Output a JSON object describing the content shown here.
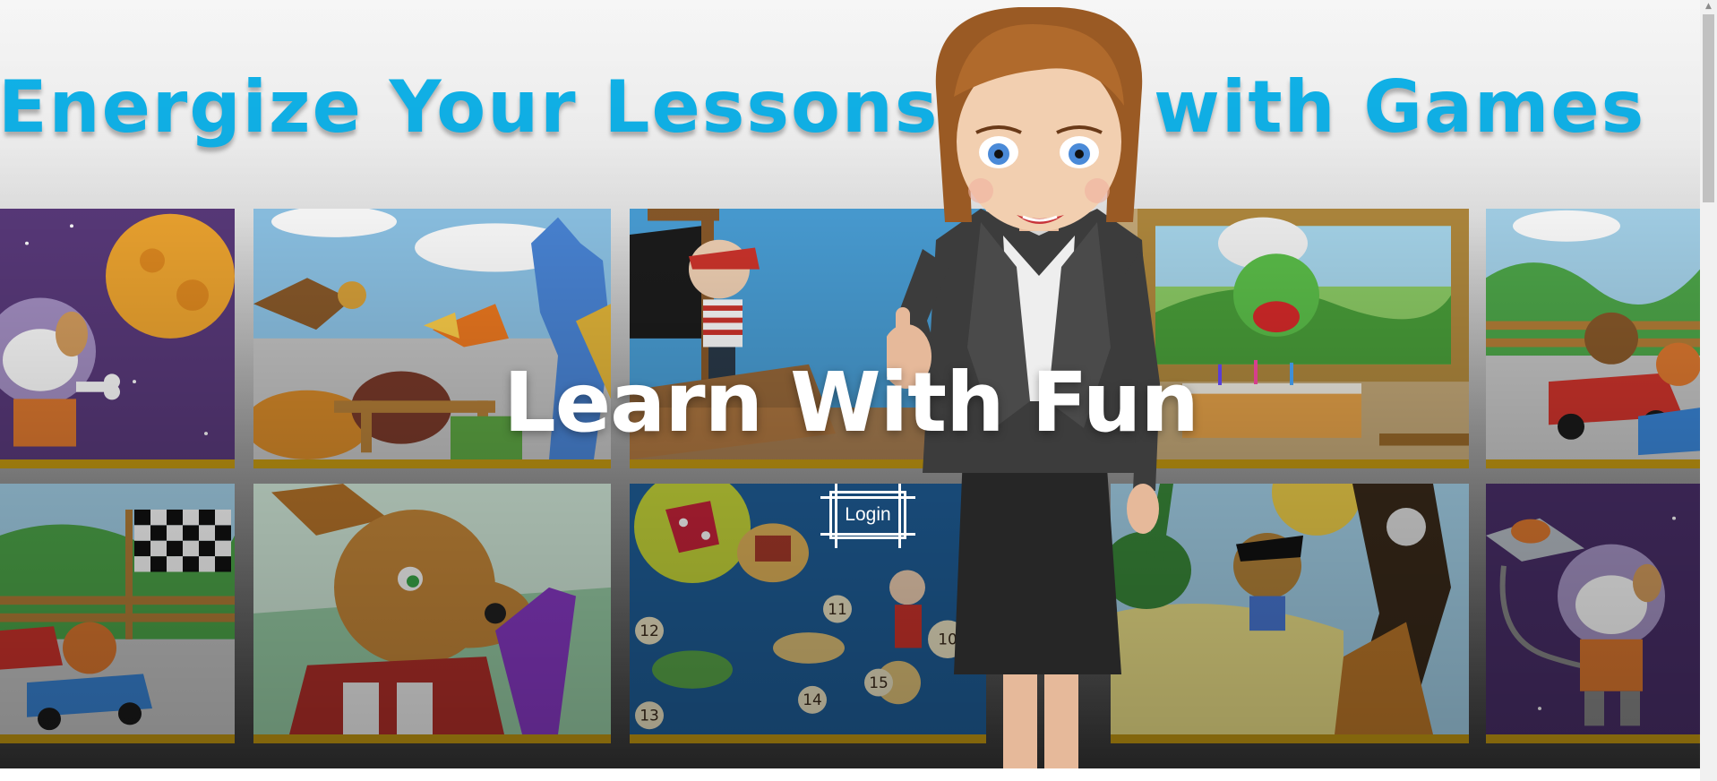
{
  "banner": {
    "headline_left": "Energize Your Lessons",
    "headline_right": "with Games",
    "title": "Learn With Fun"
  },
  "actions": {
    "login_label": "Login"
  },
  "tiles": [
    {
      "name": "tile-space-dog",
      "scene": "space-dog"
    },
    {
      "name": "tile-dragon-eagle",
      "scene": "dragon-eagle"
    },
    {
      "name": "tile-pirate-ship",
      "scene": "pirate-ship"
    },
    {
      "name": "tile-chef-cake",
      "scene": "chef-cake"
    },
    {
      "name": "tile-race-cars",
      "scene": "race-cars"
    },
    {
      "name": "tile-race-flag",
      "scene": "race-flag"
    },
    {
      "name": "tile-kangaroo",
      "scene": "kangaroo"
    },
    {
      "name": "tile-treasure-board",
      "scene": "treasure-board"
    },
    {
      "name": "tile-pirate-monkey",
      "scene": "pirate-monkey"
    },
    {
      "name": "tile-space-dog-2",
      "scene": "space-dog-2"
    }
  ],
  "board_numbers": [
    "11",
    "12",
    "15",
    "13",
    "14",
    "10"
  ],
  "colors": {
    "headline": "#10b3ea",
    "tile_border": "#c59a12"
  },
  "scrollbar": {
    "up_arrow": "▲"
  }
}
